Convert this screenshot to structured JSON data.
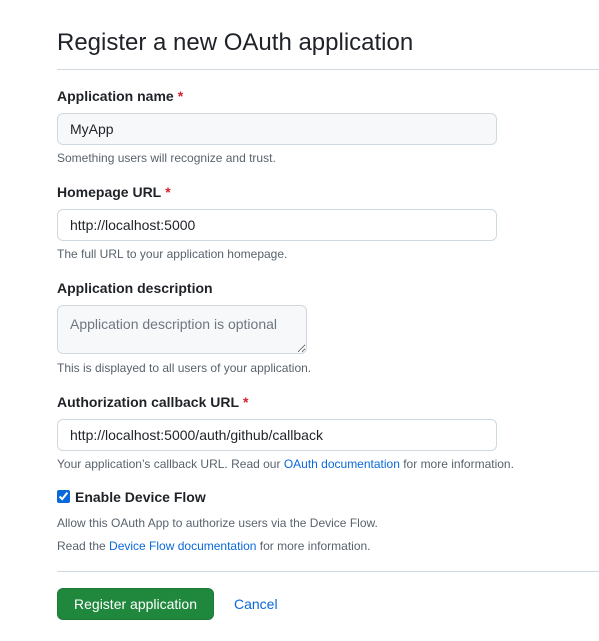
{
  "page": {
    "title": "Register a new OAuth application"
  },
  "form": {
    "app_name": {
      "label": "Application name",
      "required_mark": "*",
      "value": "MyApp",
      "note": "Something users will recognize and trust."
    },
    "homepage_url": {
      "label": "Homepage URL",
      "required_mark": "*",
      "value": "http://localhost:5000",
      "note": "The full URL to your application homepage."
    },
    "description": {
      "label": "Application description",
      "placeholder": "Application description is optional",
      "note": "This is displayed to all users of your application."
    },
    "callback_url": {
      "label": "Authorization callback URL",
      "required_mark": "*",
      "value": "http://localhost:5000/auth/github/callback",
      "note_before": "Your application’s callback URL. Read our ",
      "note_link": "OAuth documentation",
      "note_after": " for more information."
    },
    "device_flow": {
      "label": "Enable Device Flow",
      "checked": true,
      "note1": "Allow this OAuth App to authorize users via the Device Flow.",
      "note2_before": "Read the ",
      "note2_link": "Device Flow documentation",
      "note2_after": " for more information."
    }
  },
  "actions": {
    "register_label": "Register application",
    "cancel_label": "Cancel"
  },
  "colors": {
    "primary_button": "#1f883d",
    "link": "#0969da",
    "required": "#d1242f"
  }
}
